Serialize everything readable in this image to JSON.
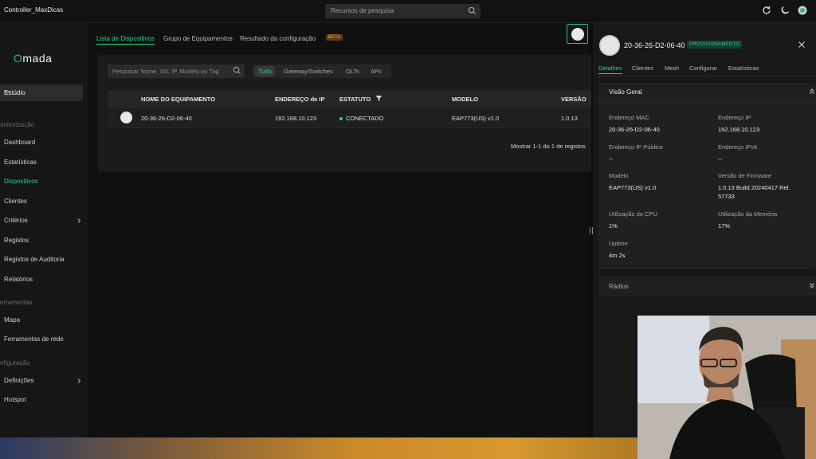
{
  "topbar": {
    "controller_name": "Controller_MaxDicas",
    "search_placeholder": "Recursos de pesquisa"
  },
  "sidebar": {
    "logo": "Omada",
    "site": "Estúdio",
    "sections": {
      "monitor": "onitorização",
      "tools": "erramentas",
      "config": "nfiguração"
    },
    "items": [
      {
        "label": "Dashboard"
      },
      {
        "label": "Estatísticas"
      },
      {
        "label": "Dispositivos"
      },
      {
        "label": "Clientes"
      },
      {
        "label": "Critérios"
      },
      {
        "label": "Registos"
      },
      {
        "label": "Registos de Auditoria"
      },
      {
        "label": "Relatórios"
      },
      {
        "label": "Mapa"
      },
      {
        "label": "Ferramentas de rede"
      },
      {
        "label": "Definições"
      },
      {
        "label": "Hotspot"
      }
    ]
  },
  "main": {
    "tabs": [
      {
        "label": "Lista de Dispositivos"
      },
      {
        "label": "Grupo de Equipamentos"
      },
      {
        "label": "Resultado da configuração"
      }
    ],
    "beta_badge": "BETA",
    "search_placeholder": "Pesquisar Nome, SN, IP, Modelo ou Tag",
    "filters": [
      "Tudo",
      "Gateway/Switches",
      "OLTs",
      "APs"
    ],
    "table": {
      "headers": [
        "NOME DO EQUIPAMENTO",
        "ENDEREÇO de IP",
        "ESTATUTO",
        "MODELO",
        "VERSÃO"
      ],
      "rows": [
        {
          "name": "20-36-26-D2-06-40",
          "ip": "192.168.10.123",
          "status": "CONECTADO",
          "model": "EAP773(US) v1.0",
          "version": "1.0.13"
        }
      ]
    },
    "pager": "Mostrar 1-1 do 1 de registos"
  },
  "panel": {
    "title": "20-36-26-D2-06-40",
    "badge": "PROVISIONAMENTO",
    "tabs": [
      "Detalhes",
      "Clientes",
      "Mesh",
      "Configurar",
      "Estatísticas"
    ],
    "overview_title": "Visão Geral",
    "fields": {
      "mac_label": "Endereço MAC",
      "mac_value": "20-36-26-D2-06-40",
      "ip_label": "Endereço IP",
      "ip_value": "192.168.10.123",
      "public_ip_label": "Endereço IP Público",
      "public_ip_value": "--",
      "ipv6_label": "Endereço IPv6",
      "ipv6_value": "--",
      "model_label": "Modelo",
      "model_value": "EAP773(US) v1.0",
      "fw_label": "Versão de Firmware",
      "fw_value_1": "1.0.13 Build 20240417 Rel.",
      "fw_value_2": "57733",
      "cpu_label": "Utilização do CPU",
      "cpu_value": "1%",
      "mem_label": "Utilização da Memória",
      "mem_value": "17%",
      "uptime_label": "Uptime",
      "uptime_value": "4m 2s"
    },
    "radios_title": "Rádios"
  },
  "colors": {
    "accent": "#2fd18a",
    "background": "#0d0d0d",
    "beta": "#f0a545"
  }
}
